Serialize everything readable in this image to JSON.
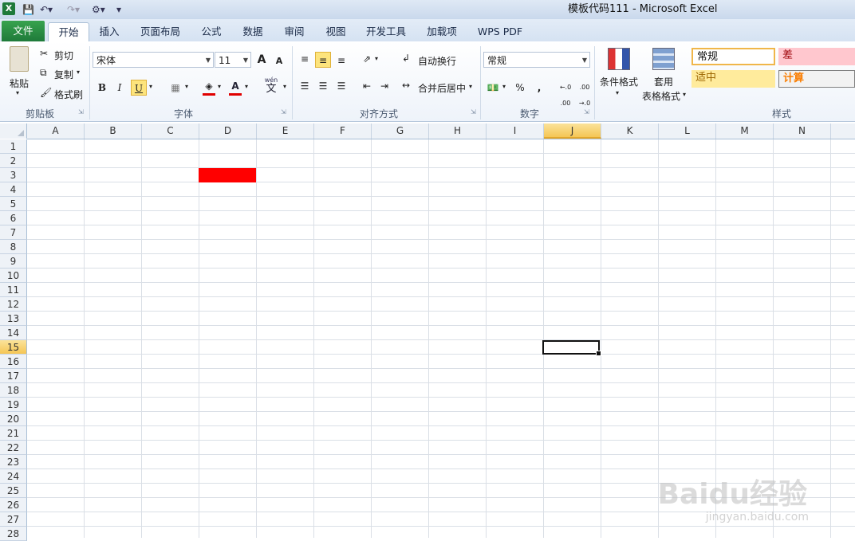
{
  "window": {
    "title": "模板代码111  -  Microsoft Excel",
    "app_icon": "X"
  },
  "tabs": [
    {
      "label": "文件",
      "kind": "file"
    },
    {
      "label": "开始",
      "kind": "active"
    },
    {
      "label": "插入"
    },
    {
      "label": "页面布局"
    },
    {
      "label": "公式"
    },
    {
      "label": "数据"
    },
    {
      "label": "审阅"
    },
    {
      "label": "视图"
    },
    {
      "label": "开发工具"
    },
    {
      "label": "加载项"
    },
    {
      "label": "WPS PDF"
    }
  ],
  "ribbon": {
    "clipboard": {
      "paste": "粘贴",
      "cut": "剪切",
      "copy": "复制",
      "format_painter": "格式刷",
      "label": "剪贴板"
    },
    "font": {
      "name": "宋体",
      "size": "11",
      "grow": "A",
      "shrink": "A",
      "bold": "B",
      "italic": "I",
      "underline": "U",
      "font_color": "A",
      "phonetic": "wén",
      "phonetic_char": "文",
      "label": "字体"
    },
    "alignment": {
      "wrap": "自动换行",
      "merge": "合并后居中",
      "label": "对齐方式"
    },
    "number": {
      "format": "常规",
      "percent": "%",
      "comma": ",",
      "inc_decimal": "←.0 .00",
      "dec_decimal": ".00 →.0",
      "label": "数字"
    },
    "styles": {
      "conditional": "条件格式",
      "table_format_1": "套用",
      "table_format_2": "表格格式",
      "normal": "常规",
      "bad": "差",
      "neutral": "适中",
      "calculation": "计算",
      "label": "样式"
    }
  },
  "sheet": {
    "columns": [
      "A",
      "B",
      "C",
      "D",
      "E",
      "F",
      "G",
      "H",
      "I",
      "J",
      "K",
      "L",
      "M",
      "N"
    ],
    "selected_column": "J",
    "rows": [
      "1",
      "2",
      "3",
      "4",
      "5",
      "6",
      "7",
      "8",
      "9",
      "10",
      "11",
      "12",
      "13",
      "14",
      "15",
      "16",
      "17",
      "18",
      "19",
      "20",
      "21",
      "22",
      "23",
      "24",
      "25",
      "26",
      "27",
      "28"
    ],
    "selected_row": "15",
    "filled_cell": {
      "ref": "D3",
      "color": "#ff0000"
    },
    "active_cell": "J15"
  },
  "watermark": {
    "brand": "Baidu经验",
    "url": "jingyan.baidu.com"
  }
}
